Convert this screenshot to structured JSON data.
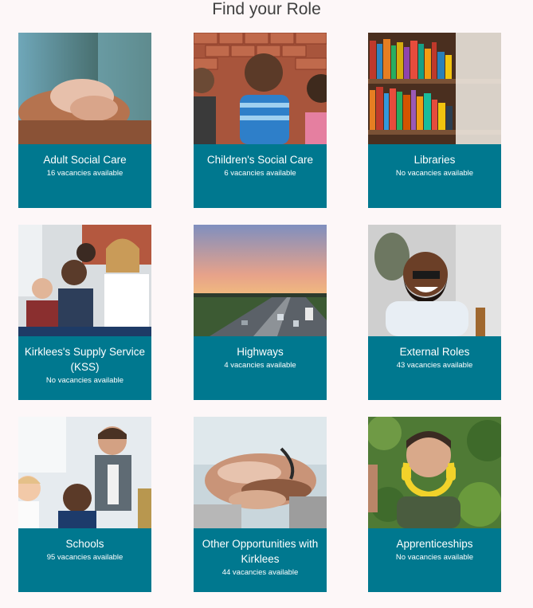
{
  "page": {
    "title": "Find your Role"
  },
  "roles": [
    {
      "name": "Adult Social Care",
      "vacancies": "16 vacancies available",
      "image": "adult-social-care-image"
    },
    {
      "name": "Children's Social Care",
      "vacancies": "6 vacancies available",
      "image": "childrens-social-care-image"
    },
    {
      "name": "Libraries",
      "vacancies": "No vacancies available",
      "image": "libraries-image"
    },
    {
      "name": "Kirklees's Supply Service (KSS)",
      "vacancies": "No vacancies available",
      "image": "supply-service-image"
    },
    {
      "name": "Highways",
      "vacancies": "4 vacancies available",
      "image": "highways-image"
    },
    {
      "name": "External Roles",
      "vacancies": "43 vacancies available",
      "image": "external-roles-image"
    },
    {
      "name": "Schools",
      "vacancies": "95 vacancies available",
      "image": "schools-image"
    },
    {
      "name": "Other Opportunities with Kirklees",
      "vacancies": "44 vacancies available",
      "image": "other-opportunities-image"
    },
    {
      "name": "Apprenticeships",
      "vacancies": "No vacancies available",
      "image": "apprenticeships-image"
    }
  ],
  "colors": {
    "card": "#00788f",
    "background": "#fdf7f8",
    "title": "#3f3f3f"
  }
}
